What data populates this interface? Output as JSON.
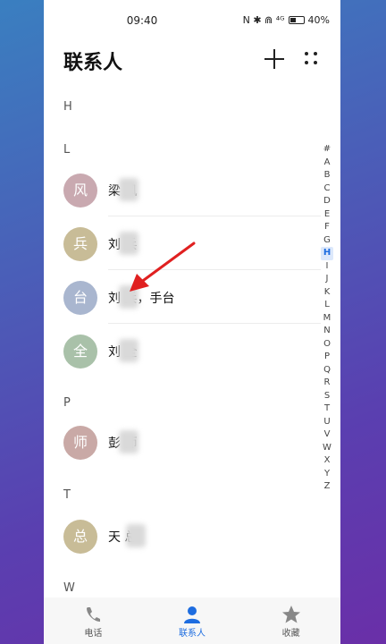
{
  "status": {
    "time": "09:40",
    "battery": "40%",
    "icons_text": "N ✱ ⋒ ⁴ᴳ"
  },
  "header": {
    "title": "联系人"
  },
  "sections": [
    {
      "letter": "H"
    },
    {
      "letter": "L"
    },
    {
      "letter": "P"
    },
    {
      "letter": "T"
    },
    {
      "letter": "W"
    }
  ],
  "contacts": [
    {
      "avatar_char": "风",
      "name": "梁    风",
      "avatar_color": "#c9a9b0"
    },
    {
      "avatar_char": "兵",
      "name": "刘    兵",
      "avatar_color": "#c8bc97"
    },
    {
      "avatar_char": "台",
      "name": "刘    兵，手台",
      "avatar_color": "#a9b6cf"
    },
    {
      "avatar_char": "全",
      "name": "刘    全",
      "avatar_color": "#a9c1a9"
    },
    {
      "avatar_char": "师",
      "name": "彭    师",
      "avatar_color": "#c9a9a6"
    },
    {
      "avatar_char": "总",
      "name": "天     总",
      "avatar_color": "#c8bc97"
    }
  ],
  "az_index": [
    "#",
    "A",
    "B",
    "C",
    "D",
    "E",
    "F",
    "G",
    "H",
    "I",
    "J",
    "K",
    "L",
    "M",
    "N",
    "O",
    "P",
    "Q",
    "R",
    "S",
    "T",
    "U",
    "V",
    "W",
    "X",
    "Y",
    "Z"
  ],
  "az_active": "H",
  "tabs": [
    {
      "label": "电话",
      "icon": "phone-icon"
    },
    {
      "label": "联系人",
      "icon": "person-icon"
    },
    {
      "label": "收藏",
      "icon": "star-icon"
    }
  ],
  "colors": {
    "accent": "#1e6de0",
    "annotation_arrow": "#e02020"
  }
}
